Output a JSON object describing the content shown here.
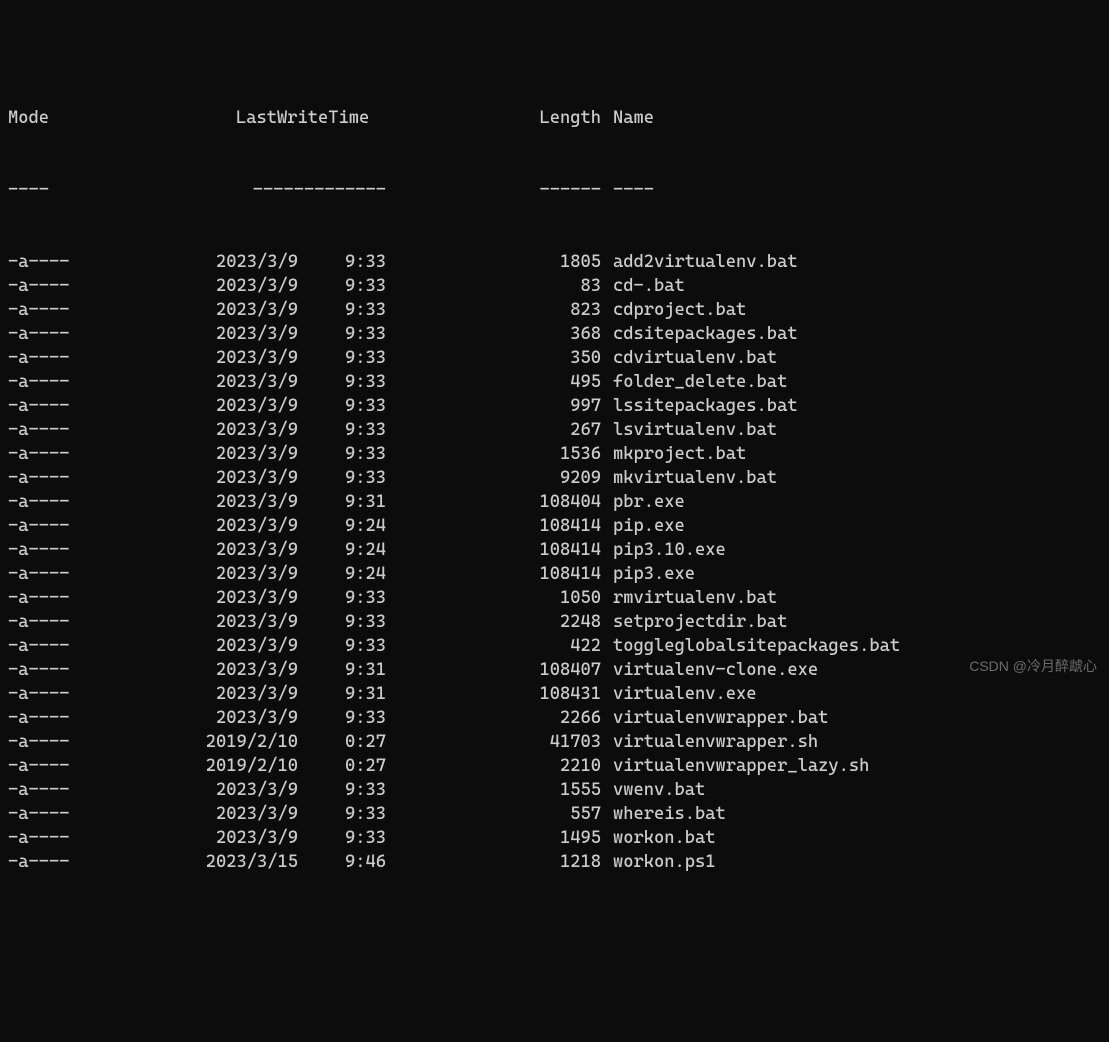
{
  "headers": {
    "mode": "Mode",
    "lastwrite": "LastWriteTime",
    "length": "Length",
    "name": "Name"
  },
  "dividers": {
    "mode": "----",
    "lastwrite": "-------------",
    "length": "------",
    "name": "----"
  },
  "rows": [
    {
      "mode": "-a----",
      "date": "2023/3/9",
      "time": "9:33",
      "length": "1805",
      "name": "add2virtualenv.bat"
    },
    {
      "mode": "-a----",
      "date": "2023/3/9",
      "time": "9:33",
      "length": "83",
      "name": "cd-.bat"
    },
    {
      "mode": "-a----",
      "date": "2023/3/9",
      "time": "9:33",
      "length": "823",
      "name": "cdproject.bat"
    },
    {
      "mode": "-a----",
      "date": "2023/3/9",
      "time": "9:33",
      "length": "368",
      "name": "cdsitepackages.bat"
    },
    {
      "mode": "-a----",
      "date": "2023/3/9",
      "time": "9:33",
      "length": "350",
      "name": "cdvirtualenv.bat"
    },
    {
      "mode": "-a----",
      "date": "2023/3/9",
      "time": "9:33",
      "length": "495",
      "name": "folder_delete.bat"
    },
    {
      "mode": "-a----",
      "date": "2023/3/9",
      "time": "9:33",
      "length": "997",
      "name": "lssitepackages.bat"
    },
    {
      "mode": "-a----",
      "date": "2023/3/9",
      "time": "9:33",
      "length": "267",
      "name": "lsvirtualenv.bat"
    },
    {
      "mode": "-a----",
      "date": "2023/3/9",
      "time": "9:33",
      "length": "1536",
      "name": "mkproject.bat"
    },
    {
      "mode": "-a----",
      "date": "2023/3/9",
      "time": "9:33",
      "length": "9209",
      "name": "mkvirtualenv.bat"
    },
    {
      "mode": "-a----",
      "date": "2023/3/9",
      "time": "9:31",
      "length": "108404",
      "name": "pbr.exe"
    },
    {
      "mode": "-a----",
      "date": "2023/3/9",
      "time": "9:24",
      "length": "108414",
      "name": "pip.exe"
    },
    {
      "mode": "-a----",
      "date": "2023/3/9",
      "time": "9:24",
      "length": "108414",
      "name": "pip3.10.exe"
    },
    {
      "mode": "-a----",
      "date": "2023/3/9",
      "time": "9:24",
      "length": "108414",
      "name": "pip3.exe"
    },
    {
      "mode": "-a----",
      "date": "2023/3/9",
      "time": "9:33",
      "length": "1050",
      "name": "rmvirtualenv.bat"
    },
    {
      "mode": "-a----",
      "date": "2023/3/9",
      "time": "9:33",
      "length": "2248",
      "name": "setprojectdir.bat"
    },
    {
      "mode": "-a----",
      "date": "2023/3/9",
      "time": "9:33",
      "length": "422",
      "name": "toggleglobalsitepackages.bat"
    },
    {
      "mode": "-a----",
      "date": "2023/3/9",
      "time": "9:31",
      "length": "108407",
      "name": "virtualenv-clone.exe"
    },
    {
      "mode": "-a----",
      "date": "2023/3/9",
      "time": "9:31",
      "length": "108431",
      "name": "virtualenv.exe"
    },
    {
      "mode": "-a----",
      "date": "2023/3/9",
      "time": "9:33",
      "length": "2266",
      "name": "virtualenvwrapper.bat"
    },
    {
      "mode": "-a----",
      "date": "2019/2/10",
      "time": "0:27",
      "length": "41703",
      "name": "virtualenvwrapper.sh"
    },
    {
      "mode": "-a----",
      "date": "2019/2/10",
      "time": "0:27",
      "length": "2210",
      "name": "virtualenvwrapper_lazy.sh"
    },
    {
      "mode": "-a----",
      "date": "2023/3/9",
      "time": "9:33",
      "length": "1555",
      "name": "vwenv.bat"
    },
    {
      "mode": "-a----",
      "date": "2023/3/9",
      "time": "9:33",
      "length": "557",
      "name": "whereis.bat"
    },
    {
      "mode": "-a----",
      "date": "2023/3/9",
      "time": "9:33",
      "length": "1495",
      "name": "workon.bat"
    },
    {
      "mode": "-a----",
      "date": "2023/3/15",
      "time": "9:46",
      "length": "1218",
      "name": "workon.ps1"
    }
  ],
  "watermark": "CSDN @冷月醉虣心"
}
